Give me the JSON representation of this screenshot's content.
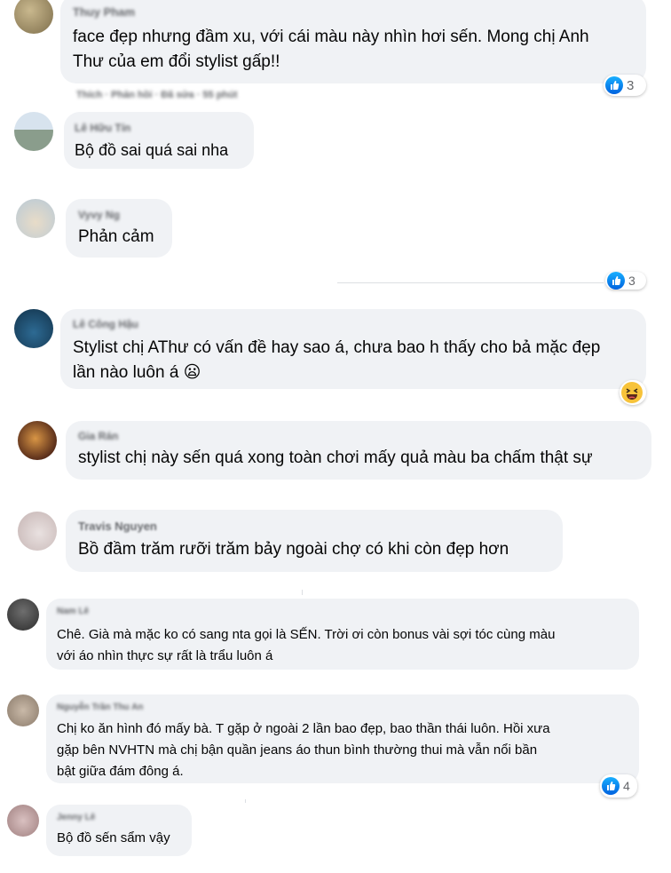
{
  "comments": [
    {
      "name": "Thuy Pham",
      "text": "face đẹp nhưng đầm xu, với cái màu này nhìn hơi sến. Mong chị Anh\nThư của em đổi stylist gấp!!",
      "reaction_count": "3"
    },
    {
      "name": "Lê Hữu Tín",
      "text": "Bộ đồ sai quá sai nha"
    },
    {
      "name": "Vyvy Ng",
      "text": "Phản cảm"
    },
    {
      "name": "Lê Công Hậu",
      "text": "Stylist chị AThư có vấn đề hay sao á, chưa bao h thấy cho bả mặc đẹp\nlần nào luôn á 😦"
    },
    {
      "name": "Gia Rán",
      "text": "stylist chị này sến quá xong toàn chơi mấy quả màu ba chấm thật sự"
    },
    {
      "name": "Travis Nguyen",
      "text": "Bồ đầm trăm rưỡi trăm bảy ngoài chợ có khi còn đẹp hơn"
    },
    {
      "name": "Nam Lê",
      "text": "Chê. Già mà mặc ko có sang nta gọi là SẾN. Trời ơi còn bonus vài sợi tóc cùng màu\nvới áo nhìn thực sự rất là trẩu luôn á"
    },
    {
      "name": "Nguyễn Trần Thu An",
      "text": "Chị ko ăn hình đó mấy bà. T gặp ở ngoài 2 lần bao đẹp, bao thần thái luôn. Hồi xưa\ngặp bên NVHTN mà chị bận quần jeans áo thun bình thường thui mà vẫn nổi bần\nbật giữa đám đông á.",
      "reaction_count": "4"
    },
    {
      "name": "Jenny Lê",
      "text": "Bộ đồ sến sẩm vậy"
    }
  ],
  "partial_reaction_count": "3",
  "partial_actions_text": "Thích · Phản hồi · Đã sửa · 55 phút"
}
